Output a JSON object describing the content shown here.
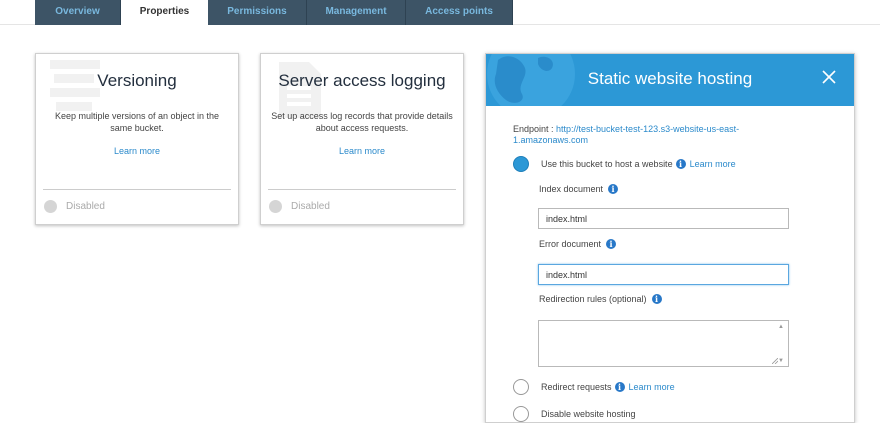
{
  "tabs": [
    {
      "label": "Overview",
      "active": false
    },
    {
      "label": "Properties",
      "active": true
    },
    {
      "label": "Permissions",
      "active": false
    },
    {
      "label": "Management",
      "active": false
    },
    {
      "label": "Access points",
      "active": false
    }
  ],
  "cards": [
    {
      "title": "Versioning",
      "description": "Keep multiple versions of an object in the same bucket.",
      "link": "Learn more",
      "status": "Disabled"
    },
    {
      "title": "Server access logging",
      "description": "Set up access log records that provide details about access requests.",
      "link": "Learn more",
      "status": "Disabled"
    }
  ],
  "panel": {
    "title": "Static website hosting",
    "close_icon": "close-icon",
    "endpoint_label": "Endpoint : ",
    "endpoint_url": "http://test-bucket-test-123.s3-website-us-east-1.amazonaws.com",
    "options": {
      "host": {
        "label": "Use this bucket to host a website",
        "link": "Learn more",
        "selected": true
      },
      "redirect": {
        "label": "Redirect requests",
        "link": "Learn more",
        "selected": false
      },
      "disable": {
        "label": "Disable website hosting",
        "selected": false
      }
    },
    "index_document": {
      "label": "Index document",
      "value": "index.html"
    },
    "error_document": {
      "label": "Error document",
      "value": "index.html"
    },
    "redirection_rules": {
      "label": "Redirection rules (optional)",
      "value": ""
    }
  },
  "colors": {
    "tab_bg": "#3d5466",
    "tab_text": "#79b8de",
    "header_blue": "#2c98d6",
    "link_blue": "#2b8acb",
    "info_icon": "#2878c8"
  }
}
